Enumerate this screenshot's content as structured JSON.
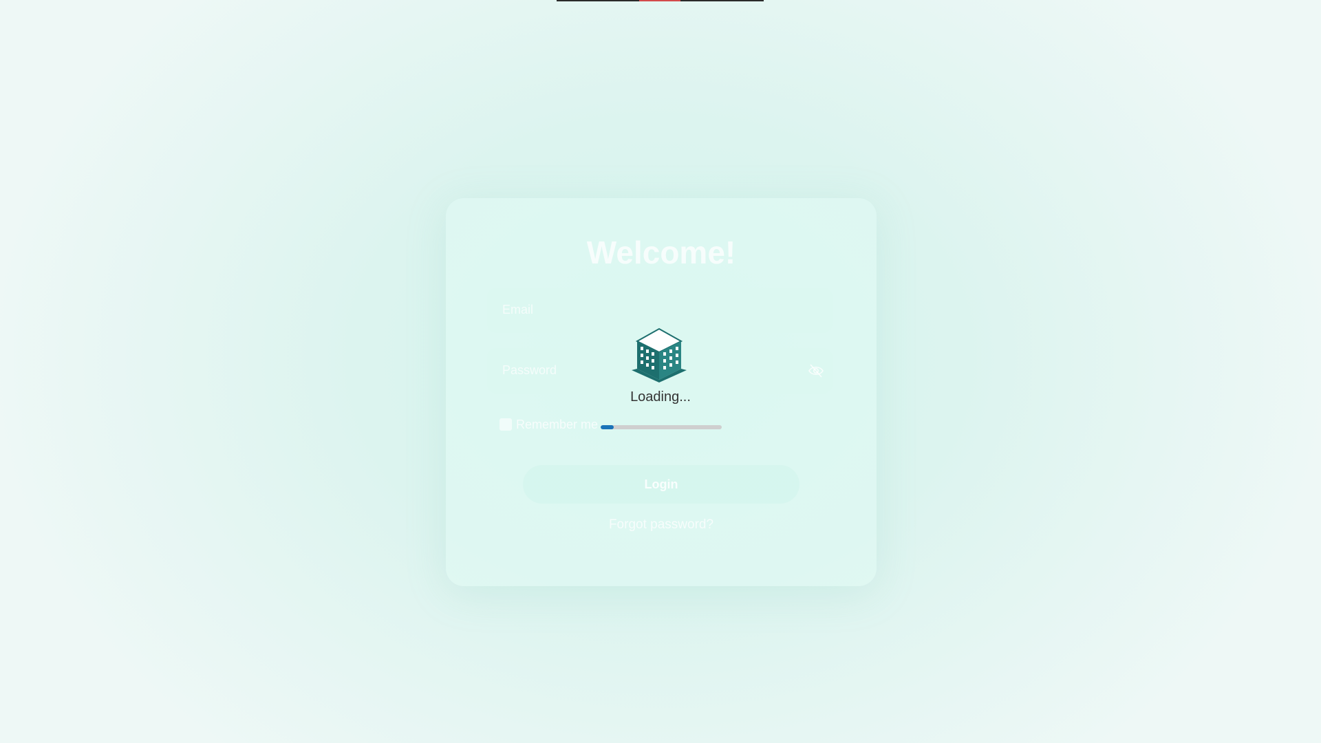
{
  "login": {
    "title": "Welcome!",
    "email_placeholder": "Email",
    "password_placeholder": "Password",
    "remember_label": "Remember me",
    "login_label": "Login",
    "forgot_label": "Forgot password?"
  },
  "loader": {
    "text": "Loading...",
    "progress_percent": 11,
    "icon": "building-icon",
    "progress_color": "#1a73b8",
    "icon_color": "#1d6f6e"
  }
}
